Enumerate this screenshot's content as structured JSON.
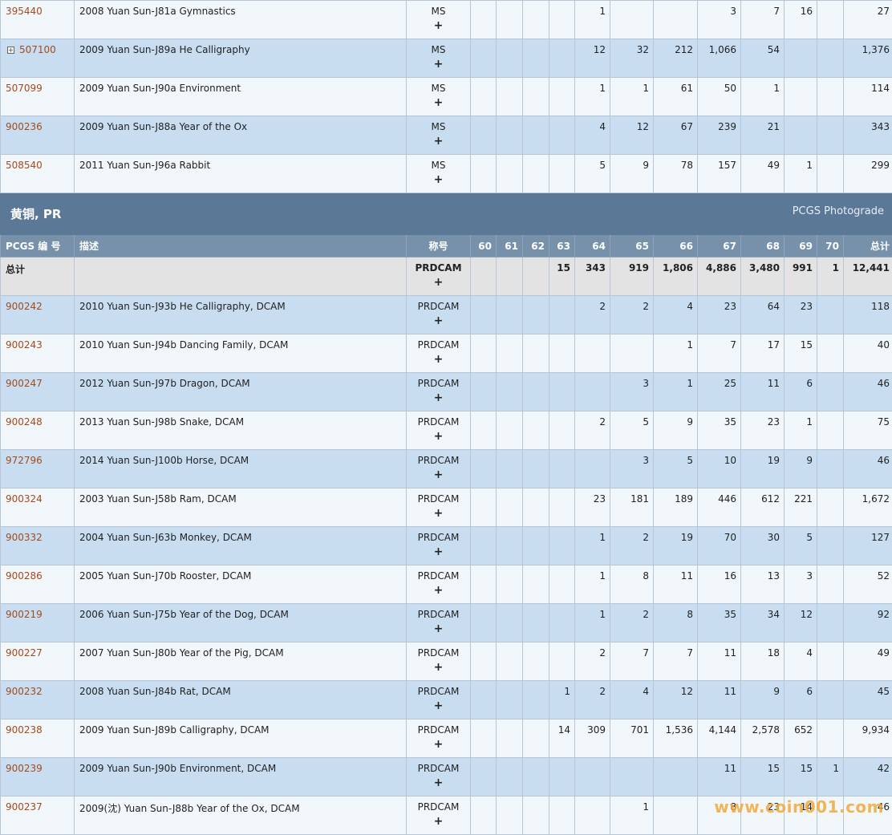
{
  "top_rows": [
    {
      "pcgs": "395440",
      "expand": false,
      "desc": "2008 Yuan Sun-J81a Gymnastics",
      "desig": "MS",
      "grades": [
        "",
        "",
        "",
        "",
        "1",
        "",
        "",
        "3",
        "7",
        "16",
        ""
      ],
      "total": "27"
    },
    {
      "pcgs": "507100",
      "expand": true,
      "desc": "2009 Yuan Sun-J89a He Calligraphy",
      "desig": "MS",
      "grades": [
        "",
        "",
        "",
        "",
        "12",
        "32",
        "212",
        "1,066",
        "54",
        "",
        ""
      ],
      "total": "1,376"
    },
    {
      "pcgs": "507099",
      "expand": false,
      "desc": "2009 Yuan Sun-J90a Environment",
      "desig": "MS",
      "grades": [
        "",
        "",
        "",
        "",
        "1",
        "1",
        "61",
        "50",
        "1",
        "",
        ""
      ],
      "total": "114"
    },
    {
      "pcgs": "900236",
      "expand": false,
      "desc": "2009 Yuan Sun-J88a Year of the Ox",
      "desig": "MS",
      "grades": [
        "",
        "",
        "",
        "",
        "4",
        "12",
        "67",
        "239",
        "21",
        "",
        ""
      ],
      "total": "343"
    },
    {
      "pcgs": "508540",
      "expand": false,
      "desc": "2011 Yuan Sun-J96a Rabbit",
      "desig": "MS",
      "grades": [
        "",
        "",
        "",
        "",
        "5",
        "9",
        "78",
        "157",
        "49",
        "1",
        ""
      ],
      "total": "299"
    }
  ],
  "section": {
    "title": "黄铜, PR",
    "link": "PCGS Photograde"
  },
  "header": {
    "pcgs": "PCGS 编 号",
    "desc": "描述",
    "desig": "称号",
    "grades": [
      "60",
      "61",
      "62",
      "63",
      "64",
      "65",
      "66",
      "67",
      "68",
      "69",
      "70"
    ],
    "total": "总计"
  },
  "total_row": {
    "label": "总计",
    "desig": "PRDCAM",
    "grades": [
      "",
      "",
      "",
      "15",
      "343",
      "919",
      "1,806",
      "4,886",
      "3,480",
      "991",
      "1"
    ],
    "total": "12,441"
  },
  "pr_rows": [
    {
      "pcgs": "900242",
      "desc": "2010 Yuan Sun-J93b He Calligraphy, DCAM",
      "desig": "PRDCAM",
      "grades": [
        "",
        "",
        "",
        "",
        "2",
        "2",
        "4",
        "23",
        "64",
        "23",
        ""
      ],
      "total": "118"
    },
    {
      "pcgs": "900243",
      "desc": "2010 Yuan Sun-J94b Dancing Family, DCAM",
      "desig": "PRDCAM",
      "grades": [
        "",
        "",
        "",
        "",
        "",
        "",
        "1",
        "7",
        "17",
        "15",
        ""
      ],
      "total": "40"
    },
    {
      "pcgs": "900247",
      "desc": "2012 Yuan Sun-J97b Dragon, DCAM",
      "desig": "PRDCAM",
      "grades": [
        "",
        "",
        "",
        "",
        "",
        "3",
        "1",
        "25",
        "11",
        "6",
        ""
      ],
      "total": "46"
    },
    {
      "pcgs": "900248",
      "desc": "2013 Yuan Sun-J98b Snake, DCAM",
      "desig": "PRDCAM",
      "grades": [
        "",
        "",
        "",
        "",
        "2",
        "5",
        "9",
        "35",
        "23",
        "1",
        ""
      ],
      "total": "75"
    },
    {
      "pcgs": "972796",
      "desc": "2014 Yuan Sun-J100b Horse, DCAM",
      "desig": "PRDCAM",
      "grades": [
        "",
        "",
        "",
        "",
        "",
        "3",
        "5",
        "10",
        "19",
        "9",
        ""
      ],
      "total": "46"
    },
    {
      "pcgs": "900324",
      "desc": "2003 Yuan Sun-J58b Ram, DCAM",
      "desig": "PRDCAM",
      "grades": [
        "",
        "",
        "",
        "",
        "23",
        "181",
        "189",
        "446",
        "612",
        "221",
        ""
      ],
      "total": "1,672"
    },
    {
      "pcgs": "900332",
      "desc": "2004 Yuan Sun-J63b Monkey, DCAM",
      "desig": "PRDCAM",
      "grades": [
        "",
        "",
        "",
        "",
        "1",
        "2",
        "19",
        "70",
        "30",
        "5",
        ""
      ],
      "total": "127"
    },
    {
      "pcgs": "900286",
      "desc": "2005 Yuan Sun-J70b Rooster, DCAM",
      "desig": "PRDCAM",
      "grades": [
        "",
        "",
        "",
        "",
        "1",
        "8",
        "11",
        "16",
        "13",
        "3",
        ""
      ],
      "total": "52"
    },
    {
      "pcgs": "900219",
      "desc": "2006 Yuan Sun-J75b Year of the Dog, DCAM",
      "desig": "PRDCAM",
      "grades": [
        "",
        "",
        "",
        "",
        "1",
        "2",
        "8",
        "35",
        "34",
        "12",
        ""
      ],
      "total": "92"
    },
    {
      "pcgs": "900227",
      "desc": "2007 Yuan Sun-J80b Year of the Pig, DCAM",
      "desig": "PRDCAM",
      "grades": [
        "",
        "",
        "",
        "",
        "2",
        "7",
        "7",
        "11",
        "18",
        "4",
        ""
      ],
      "total": "49"
    },
    {
      "pcgs": "900232",
      "desc": "2008 Yuan Sun-J84b Rat, DCAM",
      "desig": "PRDCAM",
      "grades": [
        "",
        "",
        "",
        "1",
        "2",
        "4",
        "12",
        "11",
        "9",
        "6",
        ""
      ],
      "total": "45"
    },
    {
      "pcgs": "900238",
      "desc": "2009 Yuan Sun-J89b Calligraphy, DCAM",
      "desig": "PRDCAM",
      "grades": [
        "",
        "",
        "",
        "14",
        "309",
        "701",
        "1,536",
        "4,144",
        "2,578",
        "652",
        ""
      ],
      "total": "9,934"
    },
    {
      "pcgs": "900239",
      "desc": "2009 Yuan Sun-J90b Environment, DCAM",
      "desig": "PRDCAM",
      "grades": [
        "",
        "",
        "",
        "",
        "",
        "",
        "",
        "11",
        "15",
        "15",
        "1"
      ],
      "total": "42"
    },
    {
      "pcgs": "900237",
      "desc": "2009(沈) Yuan Sun-J88b Year of the Ox, DCAM",
      "desig": "PRDCAM",
      "grades": [
        "",
        "",
        "",
        "",
        "",
        "1",
        "",
        "8",
        "23",
        "14",
        ""
      ],
      "total": "46"
    }
  ],
  "plus_symbol": "+",
  "expand_symbol": "+",
  "watermark": "www.coin001.com"
}
